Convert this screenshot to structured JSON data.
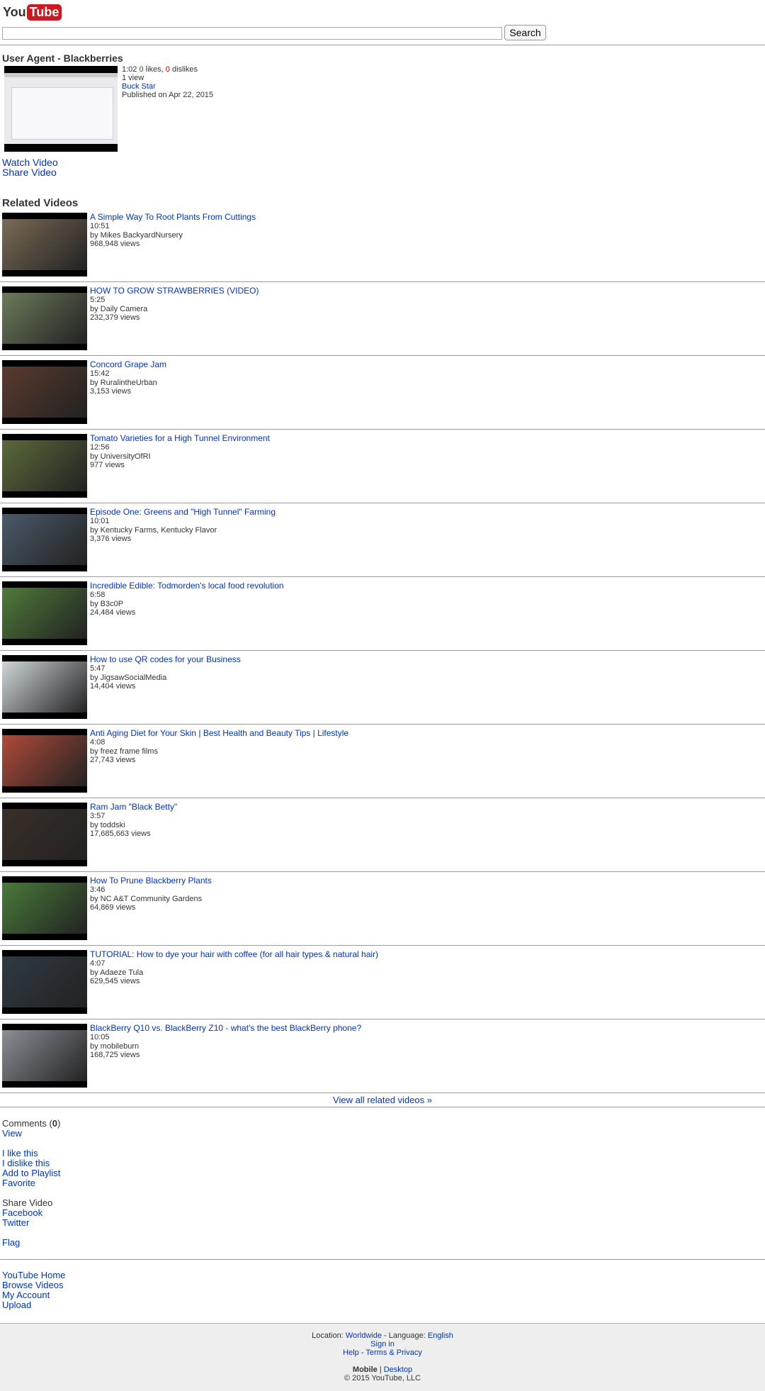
{
  "logo": {
    "text_you": "You",
    "text_tube": "Tube"
  },
  "search": {
    "placeholder": "",
    "value": "",
    "button_label": "Search"
  },
  "video": {
    "title": "User Agent - Blackberries",
    "duration": "1:02",
    "likes": "0",
    "likes_label": "likes,",
    "dislikes": "0",
    "dislikes_label": "dislikes",
    "views": "1 view",
    "uploader": "Buck Star",
    "published": "Published on Apr 22, 2015",
    "watch_label": "Watch Video",
    "share_label": "Share Video"
  },
  "related": {
    "title": "Related Videos",
    "items": [
      {
        "title": "A Simple Way To Root Plants From Cuttings",
        "duration": "10:51",
        "by": "by Mikes BackyardNursery",
        "views": "968,948 views"
      },
      {
        "title": "HOW TO GROW STRAWBERRIES (VIDEO)",
        "duration": "5:25",
        "by": "by Daily Camera",
        "views": "232,379 views"
      },
      {
        "title": "Concord Grape Jam",
        "duration": "15:42",
        "by": "by RuralintheUrban",
        "views": "3,153 views"
      },
      {
        "title": "Tomato Varieties for a High Tunnel Environment",
        "duration": "12:56",
        "by": "by UniversityOfRI",
        "views": "977 views"
      },
      {
        "title": "Episode One: Greens and \"High Tunnel\" Farming",
        "duration": "10:01",
        "by": "by Kentucky Farms, Kentucky Flavor",
        "views": "3,376 views"
      },
      {
        "title": "Incredible Edible: Todmorden's local food revolution",
        "duration": "6:58",
        "by": "by B3c0P",
        "views": "24,484 views"
      },
      {
        "title": "How to use QR codes for your Business",
        "duration": "5:47",
        "by": "by JigsawSocialMedia",
        "views": "14,404 views"
      },
      {
        "title": "Anti Aging Diet for Your Skin | Best Health and Beauty Tips | Lifestyle",
        "duration": "4:08",
        "by": "by freez frame films",
        "views": "27,743 views"
      },
      {
        "title": "Ram Jam \"Black Betty\"",
        "duration": "3:57",
        "by": "by toddski",
        "views": "17,685,663 views"
      },
      {
        "title": "How To Prune Blackberry Plants",
        "duration": "3:46",
        "by": "by NC A&T Community Gardens",
        "views": "64,869 views"
      },
      {
        "title": "TUTORIAL: How to dye your hair with coffee (for all hair types & natural hair)",
        "duration": "4:07",
        "by": "by Adaeze Tula",
        "views": "629,545 views"
      },
      {
        "title": "BlackBerry Q10 vs. BlackBerry Z10 - what's the best BlackBerry phone?",
        "duration": "10:05",
        "by": "by mobileburn",
        "views": "168,725 views"
      }
    ],
    "view_all": "View all related videos »"
  },
  "comments": {
    "label": "Comments (",
    "count": "0",
    "close": ")",
    "view_label": "View"
  },
  "actions": {
    "like": "I like this",
    "dislike": "I dislike this",
    "playlist": "Add to Playlist",
    "favorite": "Favorite"
  },
  "share": {
    "label": "Share Video",
    "facebook": "Facebook",
    "twitter": "Twitter"
  },
  "flag": "Flag",
  "nav": {
    "home": "YouTube Home",
    "browse": "Browse Videos",
    "account": "My Account",
    "upload": "Upload"
  },
  "footer": {
    "location_label": "Location:",
    "location": "Worldwide",
    "language_label": "- Language:",
    "language": "English",
    "sign_in": "Sign in",
    "help": "Help",
    "dash": "-",
    "terms": "Terms & Privacy",
    "mobile": "Mobile",
    "pipe": "|",
    "desktop": "Desktop",
    "copyright": "© 2015 YouTube, LLC"
  }
}
